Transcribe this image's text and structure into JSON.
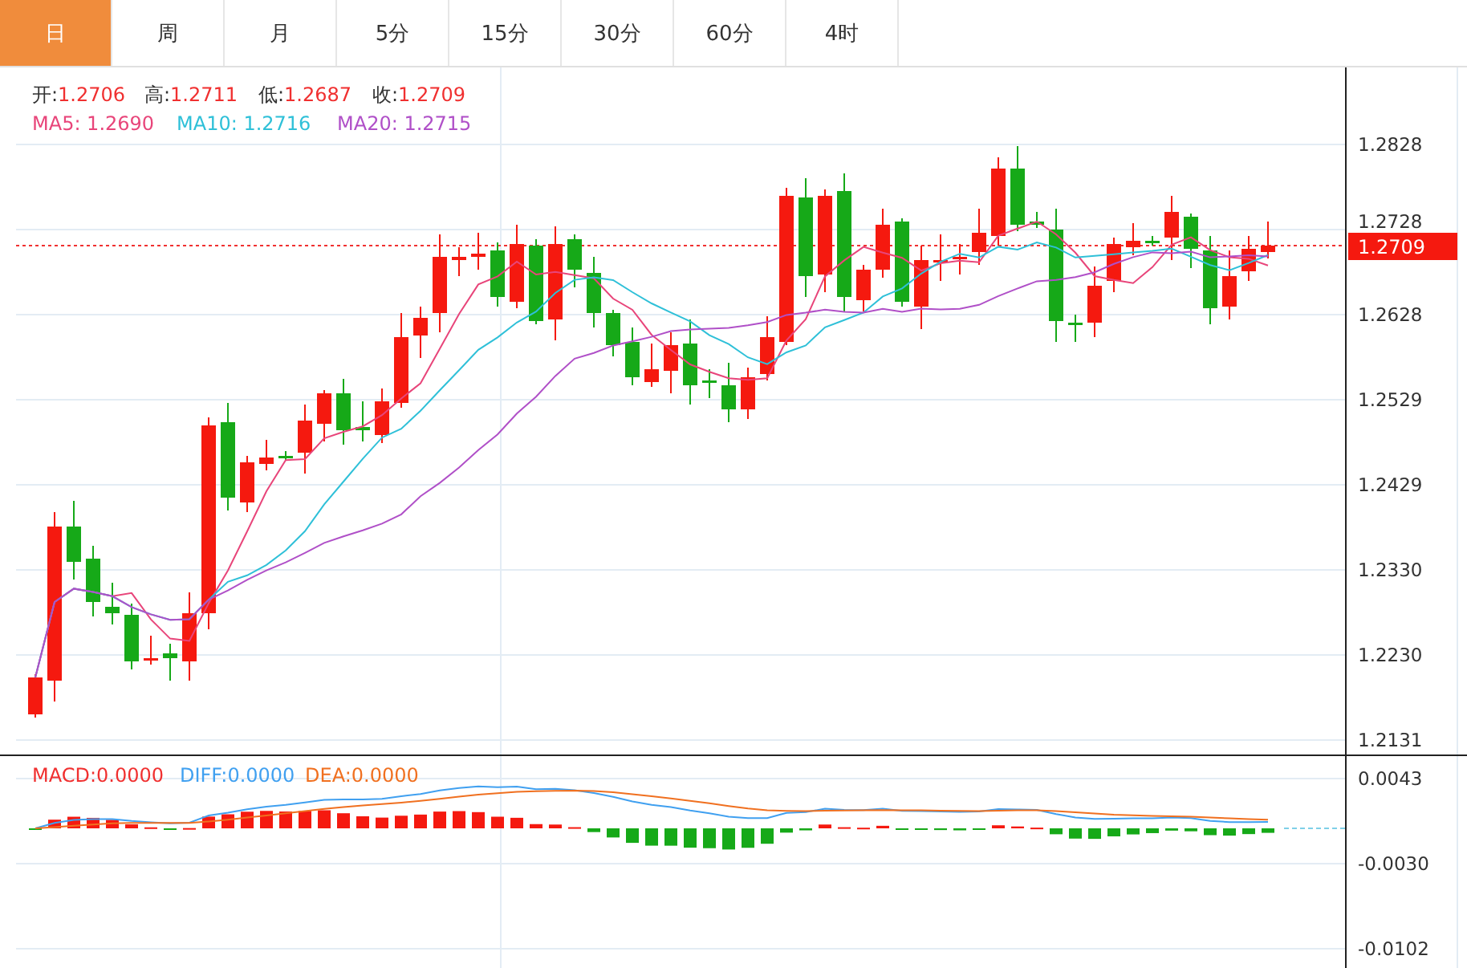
{
  "tabs": [
    {
      "label": "日",
      "selected": true
    },
    {
      "label": "周",
      "selected": false
    },
    {
      "label": "月",
      "selected": false
    },
    {
      "label": "5分",
      "selected": false
    },
    {
      "label": "15分",
      "selected": false
    },
    {
      "label": "30分",
      "selected": false
    },
    {
      "label": "60分",
      "selected": false
    },
    {
      "label": "4时",
      "selected": false
    }
  ],
  "price_panel": {
    "ohlc": [
      {
        "label": "开:",
        "value": "1.2706"
      },
      {
        "label": "高:",
        "value": "1.2711"
      },
      {
        "label": "低:",
        "value": "1.2687"
      },
      {
        "label": "收:",
        "value": "1.2709"
      }
    ],
    "moving_averages": [
      {
        "text": "MA5: 1.2690",
        "color": "#e8457a"
      },
      {
        "text": "MA10: 1.2716",
        "color": "#2fc0d8"
      },
      {
        "text": "MA20: 1.2715",
        "color": "#b050c8"
      }
    ],
    "y_axis": [
      "1.2828",
      "1.2728",
      "1.2628",
      "1.2529",
      "1.2429",
      "1.2330",
      "1.2230",
      "1.2131"
    ],
    "last_price": "1.2709"
  },
  "macd_panel": {
    "legend": [
      {
        "text": "MACD:0.0000",
        "color": "#f03030"
      },
      {
        "text": "DIFF:0.0000",
        "color": "#40a0f0"
      },
      {
        "text": "DEA:0.0000",
        "color": "#f07020"
      }
    ],
    "y_axis": [
      "0.0043",
      "-0.0030",
      "-0.0102"
    ]
  }
}
